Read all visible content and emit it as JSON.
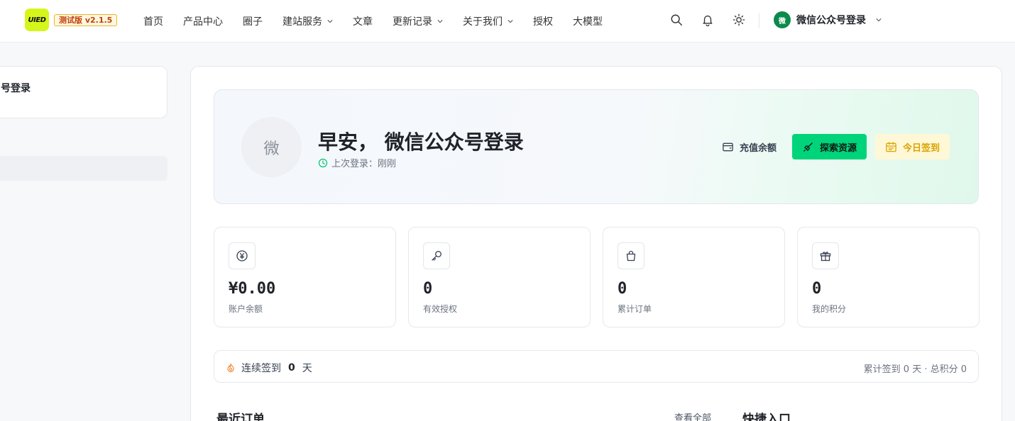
{
  "header": {
    "logo_text": "UIED",
    "version_badge": "测试版 v2.1.5",
    "nav": [
      {
        "label": "首页",
        "dropdown": false
      },
      {
        "label": "产品中心",
        "dropdown": false
      },
      {
        "label": "圈子",
        "dropdown": false
      },
      {
        "label": "建站服务",
        "dropdown": true
      },
      {
        "label": "文章",
        "dropdown": false
      },
      {
        "label": "更新记录",
        "dropdown": true
      },
      {
        "label": "关于我们",
        "dropdown": true
      },
      {
        "label": "授权",
        "dropdown": false
      },
      {
        "label": "大模型",
        "dropdown": false
      }
    ],
    "icons": [
      "search-icon",
      "bell-icon",
      "sun-icon"
    ],
    "user": {
      "avatar_char": "微",
      "name": "微信公众号登录"
    }
  },
  "sidebar": {
    "card_title": "号登录"
  },
  "hero": {
    "avatar_char": "微",
    "greeting": "早安， 微信公众号登录",
    "last_login": "上次登录：刚刚",
    "actions": {
      "recharge": "充值余额",
      "explore": "探索资源",
      "checkin": "今日签到"
    }
  },
  "stats": [
    {
      "icon": "yen-icon",
      "value": "¥0.00",
      "label": "账户余额"
    },
    {
      "icon": "key-icon",
      "value": "0",
      "label": "有效授权"
    },
    {
      "icon": "bag-icon",
      "value": "0",
      "label": "累计订单"
    },
    {
      "icon": "gift-icon",
      "value": "0",
      "label": "我的积分"
    }
  ],
  "checkin": {
    "prefix": "连续签到",
    "days": "0",
    "suffix": "天",
    "summary": "累计签到 0 天 · 总积分 0"
  },
  "sections": {
    "recent_orders": "最近订单",
    "view_all": "查看全部",
    "quick_access": "快捷入口"
  },
  "colors": {
    "accent_green": "#00d47b",
    "logo_yellow": "#d6f61b",
    "checkin_yellow": "#d9a400"
  }
}
